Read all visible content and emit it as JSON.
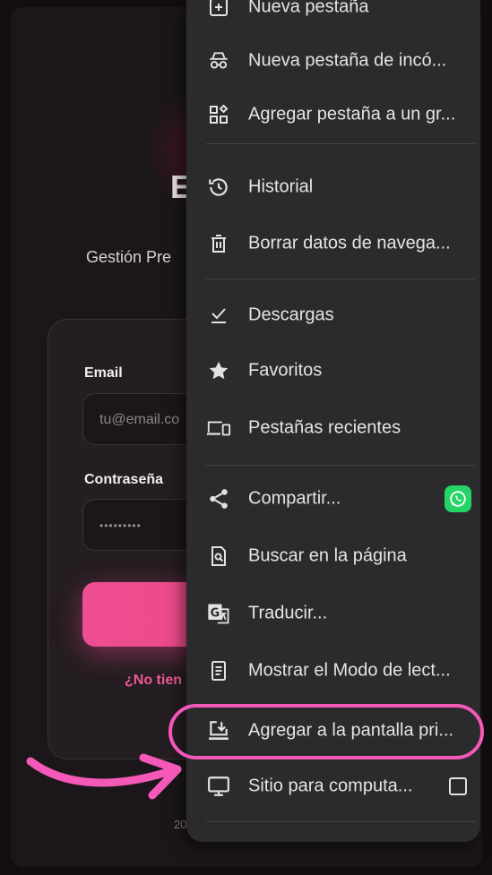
{
  "background_app": {
    "brand_partial": "E",
    "subtitle": "Gestión Pre",
    "email_label": "Email",
    "email_placeholder": "tu@email.co",
    "password_label": "Contraseña",
    "password_value": "•••••••••",
    "signup_link_partial": "¿No tien",
    "footer_partial": "20"
  },
  "menu": {
    "items": [
      {
        "label": "Nueva pestaña",
        "icon": "new-tab-icon"
      },
      {
        "label": "Nueva pestaña de incó...",
        "icon": "incognito-icon"
      },
      {
        "label": "Agregar pestaña a un gr...",
        "icon": "tab-group-icon"
      },
      {
        "label": "Historial",
        "icon": "history-icon"
      },
      {
        "label": "Borrar datos de navega...",
        "icon": "trash-icon"
      },
      {
        "label": "Descargas",
        "icon": "download-icon"
      },
      {
        "label": "Favoritos",
        "icon": "star-icon"
      },
      {
        "label": "Pestañas recientes",
        "icon": "devices-icon"
      },
      {
        "label": "Compartir...",
        "icon": "share-icon"
      },
      {
        "label": "Buscar en la página",
        "icon": "find-in-page-icon"
      },
      {
        "label": "Traducir...",
        "icon": "translate-icon"
      },
      {
        "label": "Mostrar el Modo de lect...",
        "icon": "reader-mode-icon"
      },
      {
        "label": "Agregar a la pantalla pri...",
        "icon": "add-to-home-icon"
      },
      {
        "label": "Sitio para computa...",
        "icon": "desktop-icon"
      }
    ]
  },
  "colors": {
    "accent_pink": "#ee4f92",
    "highlight": "#f458b8",
    "menu_bg": "#2b2b2d",
    "whatsapp": "#25d366"
  }
}
